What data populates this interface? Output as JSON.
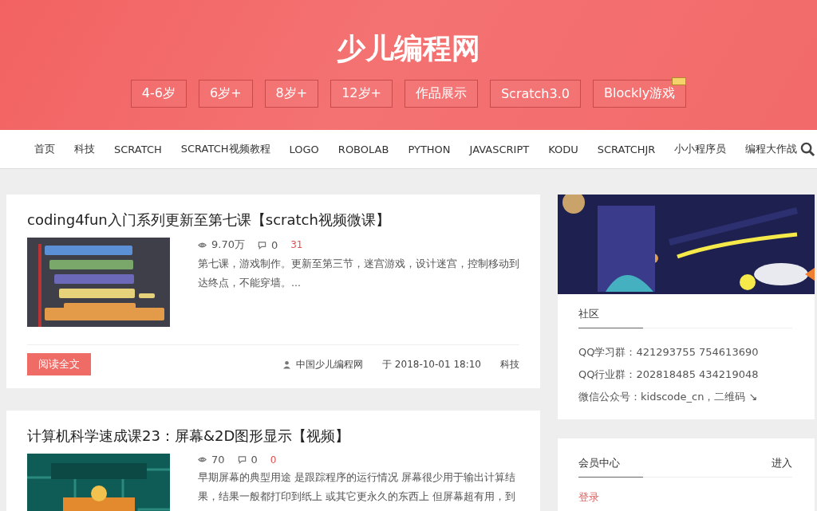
{
  "site_title": "少儿编程网",
  "age_tabs": [
    {
      "label": "4-6岁",
      "badge": false
    },
    {
      "label": "6岁+",
      "badge": false
    },
    {
      "label": "8岁+",
      "badge": false
    },
    {
      "label": "12岁+",
      "badge": false
    },
    {
      "label": "作品展示",
      "badge": false
    },
    {
      "label": "Scratch3.0",
      "badge": false
    },
    {
      "label": "Blockly游戏",
      "badge": true
    }
  ],
  "nav": [
    "首页",
    "科技",
    "SCRATCH",
    "SCRATCH视频教程",
    "LOGO",
    "ROBOLAB",
    "PYTHON",
    "JAVASCRIPT",
    "KODU",
    "SCRATCHJR",
    "小小程序员",
    "编程大作战"
  ],
  "articles": [
    {
      "title": "coding4fun入门系列更新至第七课【scratch视频微课】",
      "views": "9.70万",
      "comments": "0",
      "likes": "31",
      "excerpt": "第七课，游戏制作。更新至第三节，迷宫游戏，设计迷宫，控制移动到达终点，不能穿墙。...",
      "read_more": "阅读全文",
      "author": "中国少儿编程网",
      "date": "于 2018-10-01 18:10",
      "category": "科技"
    },
    {
      "title": "计算机科学速成课23：屏幕&2D图形显示【视频】",
      "views": "70",
      "comments": "0",
      "likes": "0",
      "excerpt": "早期屏幕的典型用途 是跟踪程序的运行情况 屏幕很少用于输出计算结果，结果一般都打印到纸上 或其它更永久的东西上 但屏幕超有用，到"
    }
  ],
  "sidebar": {
    "community": {
      "title": "社区",
      "lines": [
        "QQ学习群：421293755 754613690",
        "QQ行业群：202818485 434219048",
        "微信公众号：kidscode_cn，二维码 ↘"
      ]
    },
    "member": {
      "title": "会员中心",
      "enter": "进入",
      "login": "登录"
    }
  }
}
